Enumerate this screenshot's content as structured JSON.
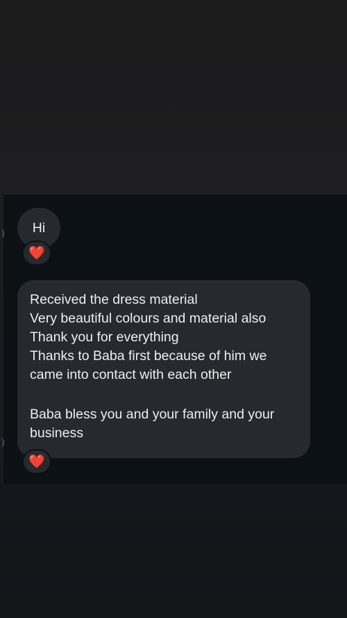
{
  "messages": [
    {
      "text": "Hi",
      "reaction": "❤️"
    },
    {
      "lines": [
        "Received the dress material",
        "Very beautiful colours and material also",
        "Thank you for everything",
        "Thanks to Baba first because of him we",
        "came into contact with each other",
        "",
        "Baba bless you and your family and your",
        "business"
      ],
      "reaction": "❤️"
    }
  ],
  "icons": {
    "reaction": "heart-icon"
  },
  "colors": {
    "chat_background": "#0c1115",
    "bubble": "#262a2e",
    "text": "#eceff1",
    "heart": "#e0263a"
  }
}
